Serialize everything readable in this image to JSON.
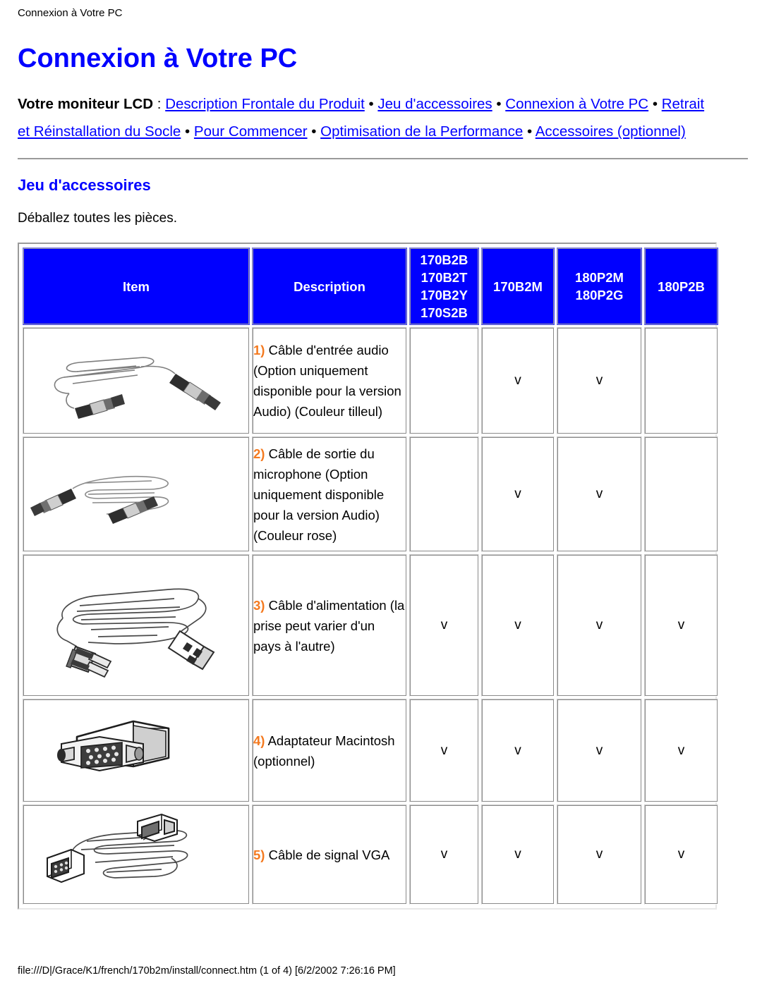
{
  "page": {
    "breadcrumb": "Connexion à Votre PC",
    "title": "Connexion à Votre PC",
    "footer": "file:///D|/Grace/K1/french/170b2m/install/connect.htm (1 of 4) [6/2/2002 7:26:16 PM]"
  },
  "nav": {
    "lead": "Votre moniteur LCD",
    "colon": " : ",
    "separator": " • ",
    "links": [
      "Description Frontale du Produit",
      "Jeu d'accessoires",
      "Connexion à Votre PC",
      "Retrait et Réinstallation du Socle",
      "Pour Commencer",
      "Optimisation de la Performance",
      "Accessoires (optionnel)"
    ]
  },
  "section": {
    "heading": "Jeu d'accessoires",
    "intro": "Déballez toutes les pièces."
  },
  "table": {
    "headers": {
      "item": "Item",
      "description": "Description",
      "col_170b2b": [
        "170B2B",
        "170B2T",
        "170B2Y",
        "170S2B"
      ],
      "col_170b2m": [
        "170B2M"
      ],
      "col_180p2m": [
        "180P2M",
        "180P2G"
      ],
      "col_180p2b": [
        "180P2B"
      ]
    },
    "check_mark": "v",
    "rows": [
      {
        "icon": "audio-input-cable-icon",
        "number": "1)",
        "description": " Câble d'entrée audio (Option uniquement disponible pour la version Audio) (Couleur tilleul)",
        "checks": [
          "",
          "v",
          "v",
          ""
        ]
      },
      {
        "icon": "microphone-output-cable-icon",
        "number": "2)",
        "description": " Câble de sortie du microphone (Option uniquement disponible pour la version Audio)(Couleur rose)",
        "checks": [
          "",
          "v",
          "v",
          ""
        ]
      },
      {
        "icon": "power-cable-icon",
        "number": "3)",
        "description": " Câble d'alimentation (la prise peut varier d'un pays à l'autre)",
        "checks": [
          "v",
          "v",
          "v",
          "v"
        ]
      },
      {
        "icon": "macintosh-adapter-icon",
        "number": "4)",
        "description": " Adaptateur Macintosh (optionnel)",
        "checks": [
          "v",
          "v",
          "v",
          "v"
        ]
      },
      {
        "icon": "vga-signal-cable-icon",
        "number": "5)",
        "description": " Câble de signal VGA",
        "checks": [
          "v",
          "v",
          "v",
          "v"
        ]
      }
    ]
  },
  "colors": {
    "header_blue": "#0000FF",
    "link_blue": "#0000FF",
    "number_orange": "#F47A20",
    "text_black": "#000000"
  }
}
